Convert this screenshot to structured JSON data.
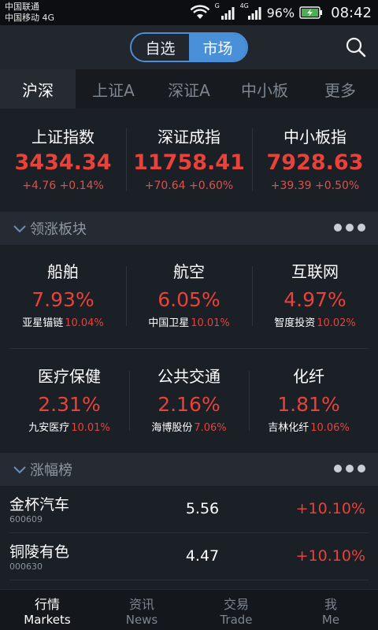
{
  "status_bar": {
    "carrier_1": "中国联通",
    "carrier_2": "中国移动 4G",
    "signal_1_label": "G",
    "signal_2_label": "4G",
    "battery": "96%",
    "time": "08:42"
  },
  "header": {
    "segments": [
      {
        "label": "自选",
        "active": false
      },
      {
        "label": "市场",
        "active": true
      }
    ],
    "search_icon": "search-icon"
  },
  "tabs": [
    {
      "label": "沪深",
      "active": true
    },
    {
      "label": "上证A",
      "active": false
    },
    {
      "label": "深证A",
      "active": false
    },
    {
      "label": "中小板",
      "active": false
    },
    {
      "label": "更多",
      "active": false
    }
  ],
  "indices": [
    {
      "name": "上证指数",
      "value": "3434.34",
      "change": "+4.76 +0.14%"
    },
    {
      "name": "深证成指",
      "value": "11758.41",
      "change": "+70.64 +0.60%"
    },
    {
      "name": "中小板指",
      "value": "7928.63",
      "change": "+39.39 +0.50%"
    }
  ],
  "sectors_section": {
    "title": "领涨板块",
    "more_icon": "more-dots-icon"
  },
  "sectors": [
    {
      "name": "船舶",
      "pct": "7.93%",
      "lead_stock": "亚星锚链",
      "lead_pct": "10.04%"
    },
    {
      "name": "航空",
      "pct": "6.05%",
      "lead_stock": "中国卫星",
      "lead_pct": "10.01%"
    },
    {
      "name": "互联网",
      "pct": "4.97%",
      "lead_stock": "智度投资",
      "lead_pct": "10.02%"
    },
    {
      "name": "医疗保健",
      "pct": "2.31%",
      "lead_stock": "九安医疗",
      "lead_pct": "10.01%"
    },
    {
      "name": "公共交通",
      "pct": "2.16%",
      "lead_stock": "海博股份",
      "lead_pct": "7.06%"
    },
    {
      "name": "化纤",
      "pct": "1.81%",
      "lead_stock": "吉林化纤",
      "lead_pct": "10.06%"
    }
  ],
  "gainers_section": {
    "title": "涨幅榜",
    "more_icon": "more-dots-icon"
  },
  "gainers": [
    {
      "name": "金杯汽车",
      "code": "600609",
      "price": "5.56",
      "pct": "+10.10%"
    },
    {
      "name": "铜陵有色",
      "code": "000630",
      "price": "4.47",
      "pct": "+10.10%"
    }
  ],
  "bottom_nav": [
    {
      "cn": "行情",
      "en": "Markets",
      "active": true
    },
    {
      "cn": "资讯",
      "en": "News",
      "active": false
    },
    {
      "cn": "交易",
      "en": "Trade",
      "active": false
    },
    {
      "cn": "我",
      "en": "Me",
      "active": false
    }
  ],
  "colors": {
    "accent": "#4a90d9",
    "up_red": "#e8423a",
    "background": "#1b1f26"
  }
}
